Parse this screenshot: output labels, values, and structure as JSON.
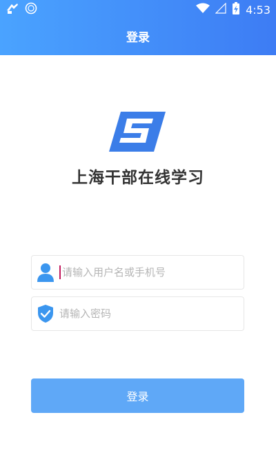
{
  "status_bar": {
    "time": "4:53",
    "icons": [
      "notification-icon",
      "app-notification-icon",
      "wifi-icon",
      "signal-icon",
      "battery-charging-icon"
    ]
  },
  "header": {
    "title": "登录"
  },
  "branding": {
    "app_name": "上海干部在线学习",
    "logo_icon": "app-logo-icon"
  },
  "form": {
    "username": {
      "value": "",
      "placeholder": "请输入用户名或手机号",
      "icon": "user-icon"
    },
    "password": {
      "value": "",
      "placeholder": "请输入密码",
      "icon": "shield-check-icon"
    },
    "submit_label": "登录"
  },
  "colors": {
    "header_gradient_start": "#4aa3ff",
    "header_gradient_end": "#3d7cf4",
    "logo": "#3b7de8",
    "icon_blue": "#3b96ef",
    "button": "#5fa8f7",
    "caret": "#c2185b"
  }
}
